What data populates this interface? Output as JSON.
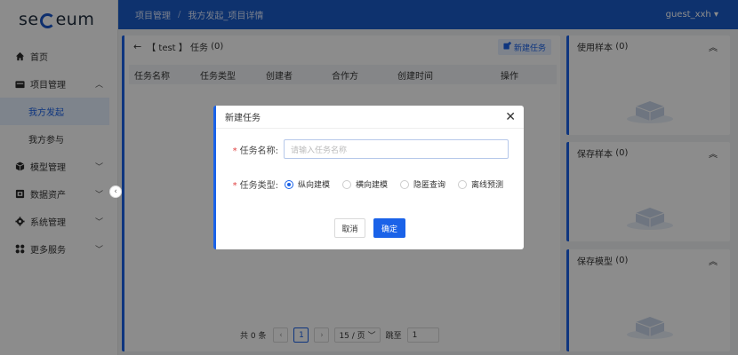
{
  "brand": {
    "logo_left": "se",
    "logo_right": "eum"
  },
  "sidebar": {
    "items": [
      {
        "label": "首页",
        "icon": "home-icon"
      },
      {
        "label": "项目管理",
        "icon": "folder-icon"
      },
      {
        "label": "我方发起"
      },
      {
        "label": "我方参与"
      },
      {
        "label": "模型管理",
        "icon": "cube-icon"
      },
      {
        "label": "数据资产",
        "icon": "database-icon"
      },
      {
        "label": "系统管理",
        "icon": "gear-icon"
      },
      {
        "label": "更多服务",
        "icon": "grid-icon"
      }
    ]
  },
  "topbar": {
    "crumb1": "项目管理",
    "sep": "/",
    "crumb2": "我方发起_项目详情",
    "user": "guest_xxh"
  },
  "main": {
    "title_project": "【 test 】",
    "title_label": "任务",
    "title_count": "(0)",
    "new_task_label": "新建任务",
    "columns": [
      "任务名称",
      "任务类型",
      "创建者",
      "合作方",
      "创建时间",
      "操作"
    ]
  },
  "pager": {
    "total": "共 0 条",
    "page": "1",
    "size": "15 / 页",
    "jump_label": "跳至",
    "jump_value": "1"
  },
  "side_cards": [
    {
      "title": "使用样本",
      "count": "(0)"
    },
    {
      "title": "保存样本",
      "count": "(0)"
    },
    {
      "title": "保存模型",
      "count": "(0)"
    }
  ],
  "modal": {
    "title": "新建任务",
    "name_label": "任务名称:",
    "name_placeholder": "请输入任务名称",
    "type_label": "任务类型:",
    "types": [
      "纵向建模",
      "横向建模",
      "隐匿查询",
      "离线预测"
    ],
    "selected_type": "纵向建模",
    "cancel": "取消",
    "confirm": "确定"
  },
  "colors": {
    "accent": "#1a62e8",
    "topbar": "#1a5bc9"
  }
}
